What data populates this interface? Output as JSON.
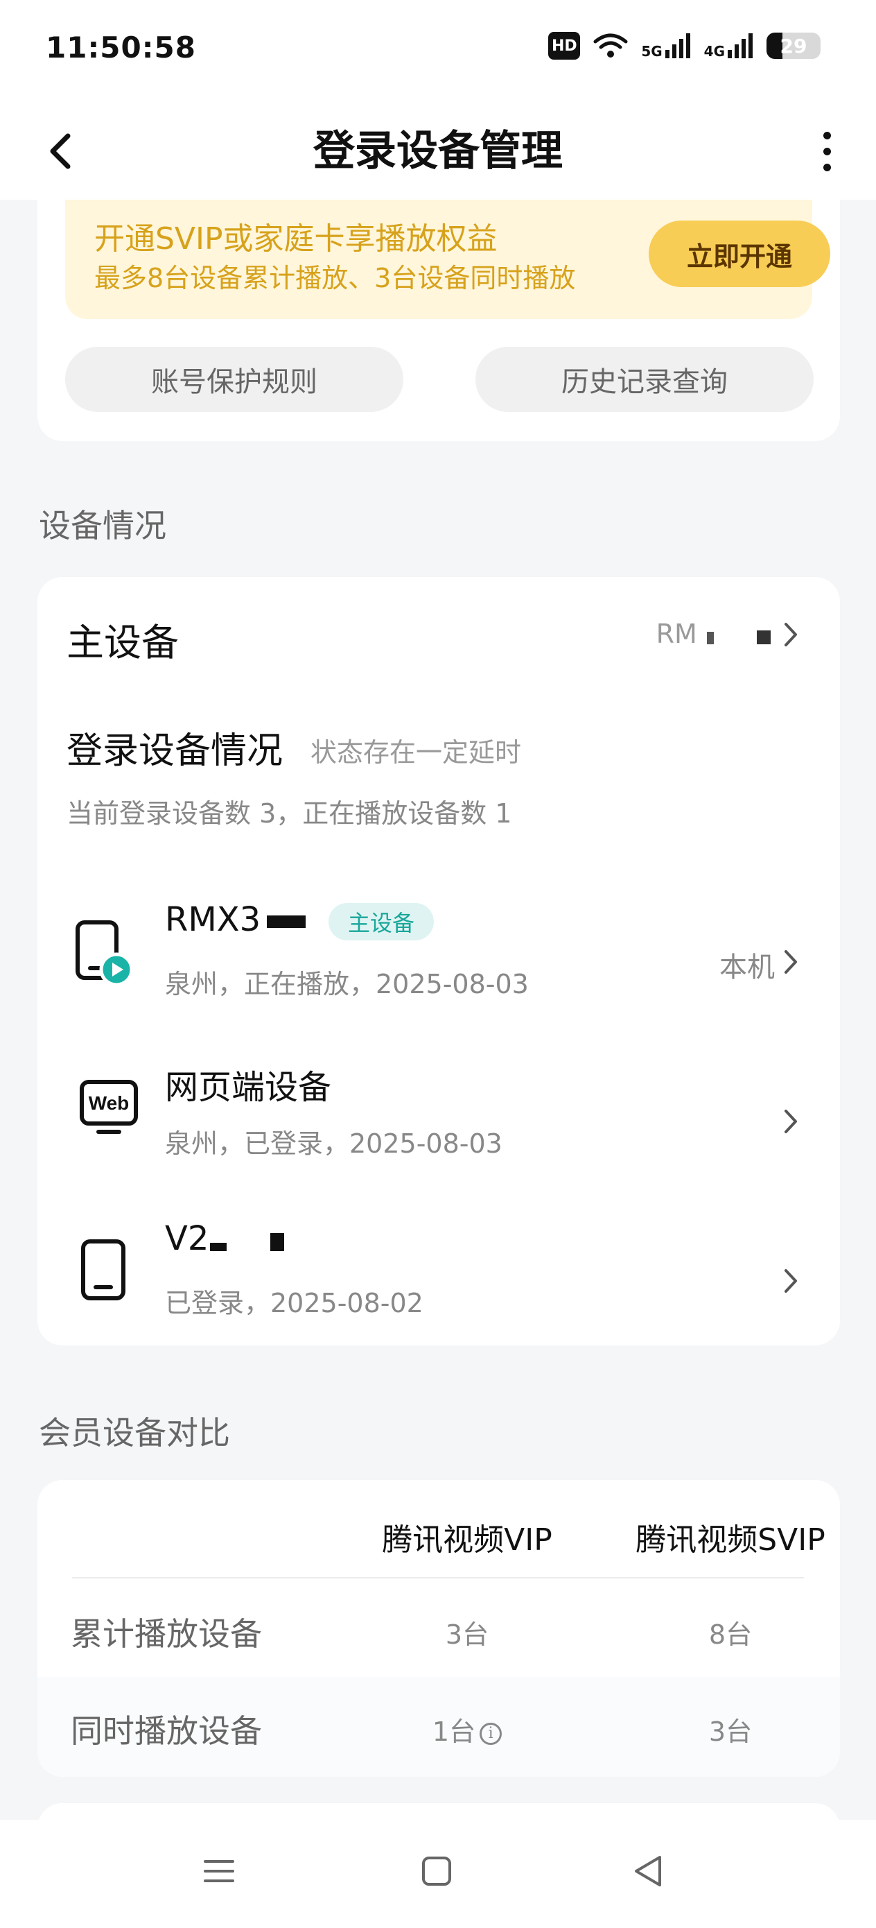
{
  "status_bar": {
    "time": "11:50:58",
    "hd": "HD",
    "sim1": "5G",
    "sim2": "4G",
    "battery": "29",
    "battery_level": 0.29
  },
  "header": {
    "title": "登录设备管理"
  },
  "banner": {
    "line1": "开通SVIP或家庭卡享播放权益",
    "line2": "最多8台设备累计播放、3台设备同时播放",
    "button": "立即开通",
    "accent": "#d7a21b"
  },
  "links": {
    "protect_rules": "账号保护规则",
    "history": "历史记录查询"
  },
  "devices_section": {
    "heading": "设备情况",
    "main_device_label": "主设备",
    "main_device_value": "RM",
    "login_title": "登录设备情况",
    "login_note": "状态存在一定延时",
    "login_count": "当前登录设备数 3，正在播放设备数 1",
    "devices": [
      {
        "name": "RMX3",
        "tag": "主设备",
        "sub": "泉州，正在播放，2025-08-03",
        "right": "本机"
      },
      {
        "name": "网页端设备",
        "sub": "泉州，已登录，2025-08-03",
        "icon_text": "Web"
      },
      {
        "name": "V2",
        "sub": "已登录，2025-08-02"
      }
    ]
  },
  "compare_section": {
    "heading": "会员设备对比",
    "columns": [
      "腾讯视频VIP",
      "腾讯视频SVIP"
    ],
    "rows": [
      {
        "label": "累计播放设备",
        "vip": "3台",
        "svip": "8台"
      },
      {
        "label": "同时播放设备",
        "vip": "1台",
        "svip": "3台"
      }
    ]
  }
}
